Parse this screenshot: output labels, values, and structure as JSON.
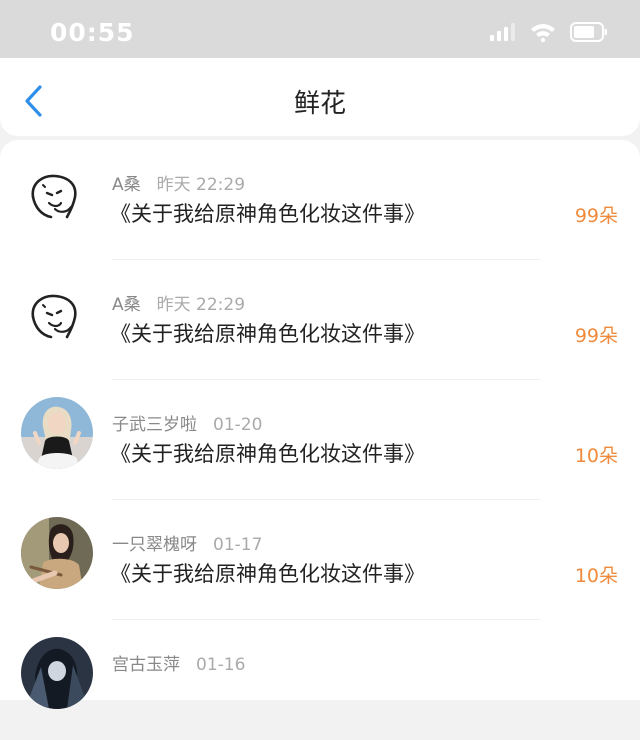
{
  "status_bar": {
    "time": "00:55",
    "icons": [
      "signal-icon",
      "wifi-icon",
      "battery-icon"
    ]
  },
  "header": {
    "back_icon": "chevron-left-icon",
    "title": "鲜花"
  },
  "items": [
    {
      "name": "A桑",
      "time": "昨天 22:29",
      "work": "《关于我给原神角色化妆这件事》",
      "count": "99朵",
      "avatar": "doodle-avatar"
    },
    {
      "name": "A桑",
      "time": "昨天 22:29",
      "work": "《关于我给原神角色化妆这件事》",
      "count": "99朵",
      "avatar": "doodle-avatar"
    },
    {
      "name": "子武三岁啦",
      "time": "01-20",
      "work": "《关于我给原神角色化妆这件事》",
      "count": "10朵",
      "avatar": "photo-avatar"
    },
    {
      "name": "一只翠槐呀",
      "time": "01-17",
      "work": "《关于我给原神角色化妆这件事》",
      "count": "10朵",
      "avatar": "photo-avatar"
    },
    {
      "name": "宫古玉萍",
      "time": "01-16",
      "work": "",
      "count": "",
      "avatar": "photo-avatar"
    }
  ],
  "colors": {
    "accent": "#2f8fe8",
    "count": "#f08a3c",
    "status_bar": "#dadada"
  }
}
